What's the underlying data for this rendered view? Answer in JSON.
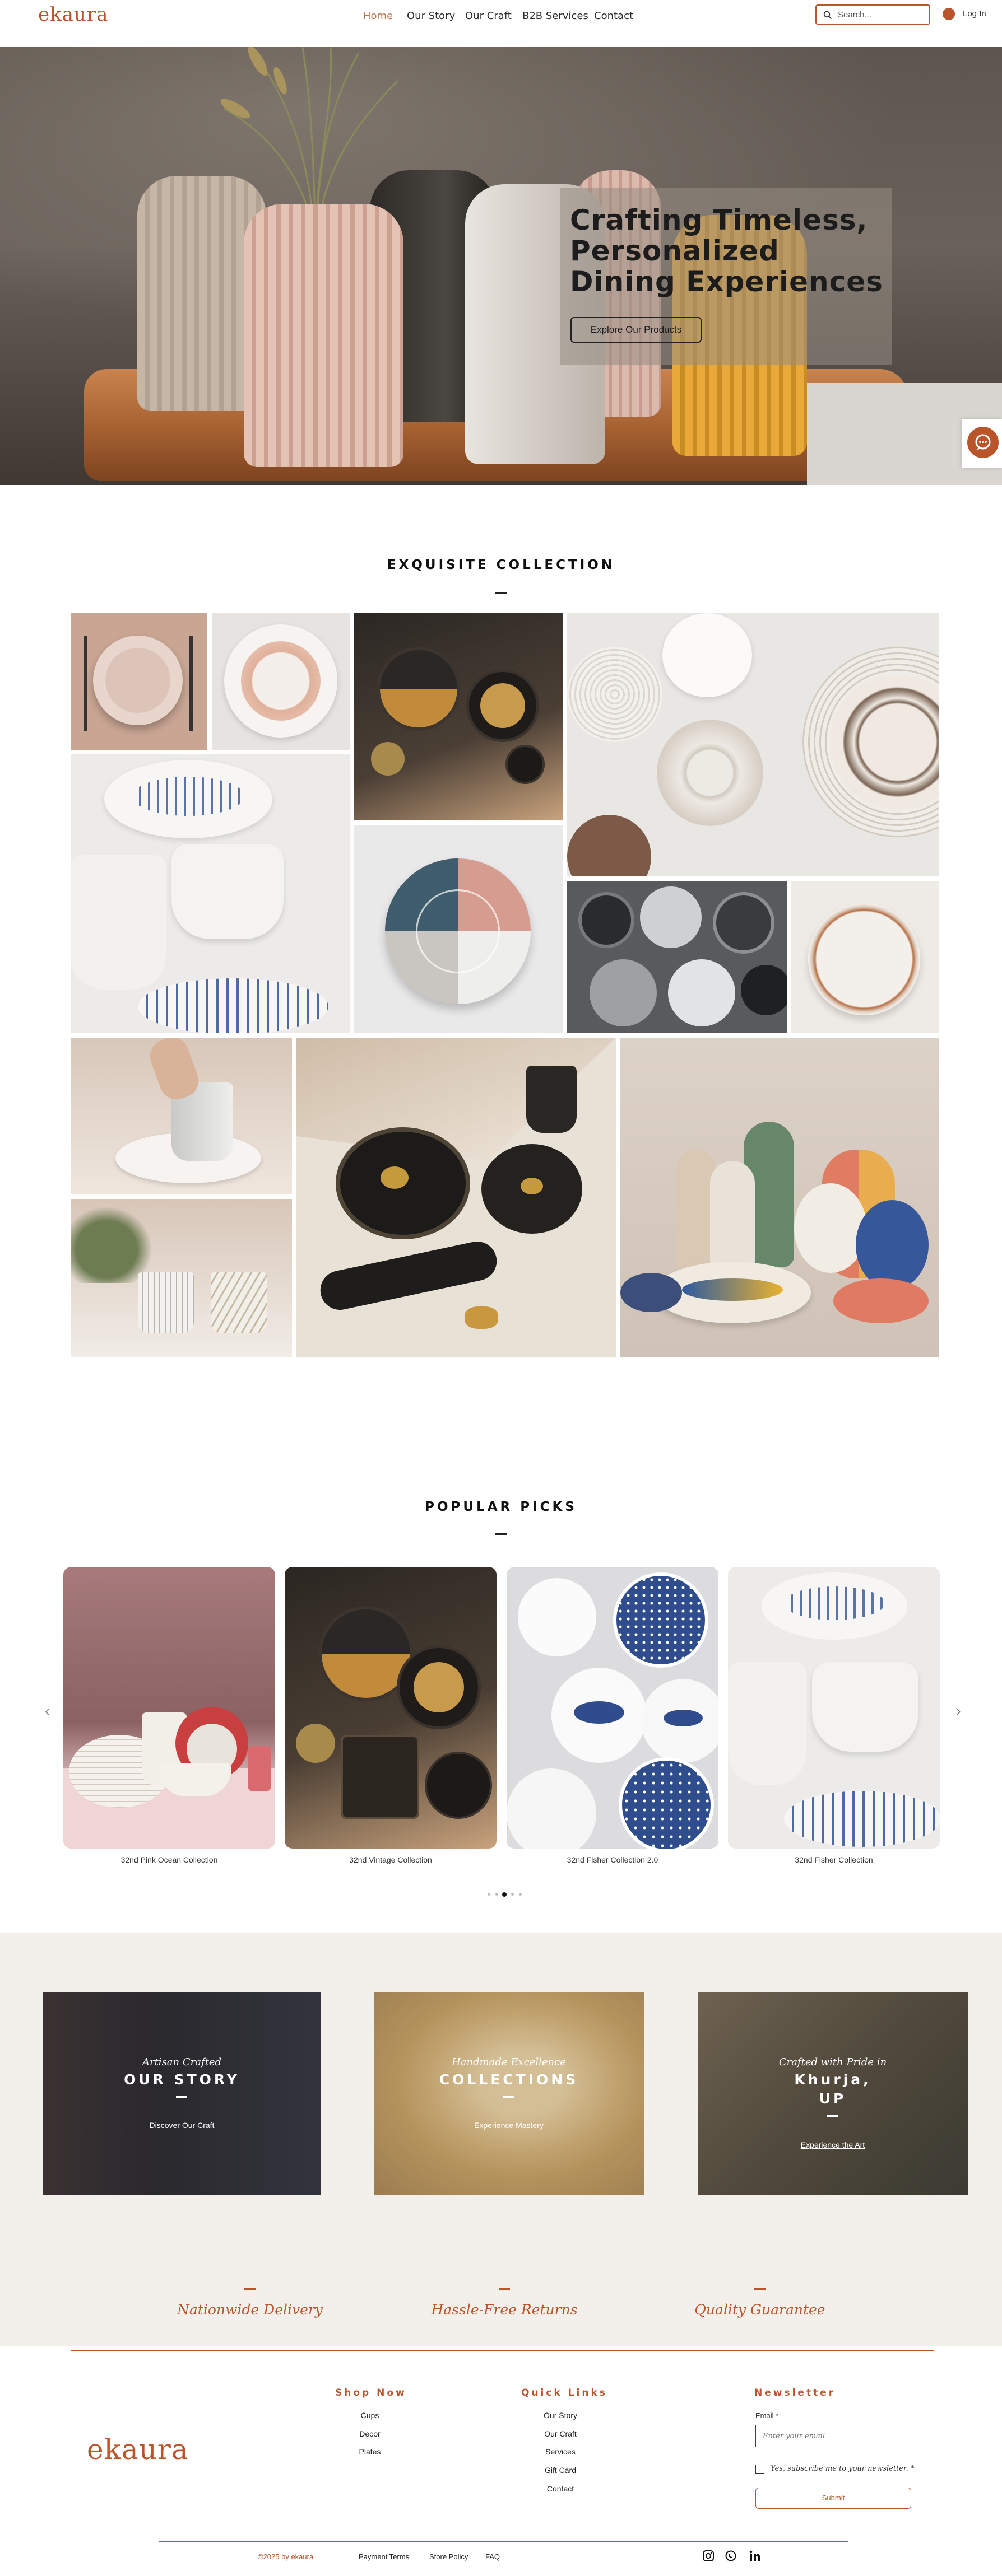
{
  "header": {
    "logo": "ekaura",
    "nav": [
      "Home",
      "Our Story",
      "Our Craft",
      "B2B Services",
      "Contact"
    ],
    "search_placeholder": "Search...",
    "login": "Log In"
  },
  "hero": {
    "title": "Crafting Timeless, Personalized Dining Experiences",
    "button": "Explore Our Products"
  },
  "collection": {
    "title": "EXQUISITE COLLECTION"
  },
  "popular": {
    "title": "POPULAR PICKS",
    "items": [
      "32nd Pink Ocean Collection",
      "32nd Vintage Collection",
      "32nd Fisher Collection 2.0",
      "32nd Fisher Collection"
    ]
  },
  "story": {
    "panels": [
      {
        "italic": "Artisan Crafted",
        "title": "OUR STORY",
        "link": "Discover Our Craft"
      },
      {
        "italic": "Handmade Excellence",
        "title": "COLLECTIONS",
        "link": "Experience Mastery"
      },
      {
        "italic": "Crafted with Pride in",
        "title": "Khurja,",
        "title2": "UP",
        "link": "Experience the Art"
      }
    ],
    "features": [
      "Nationwide Delivery",
      "Hassle-Free Returns",
      "Quality Guarantee"
    ]
  },
  "footer": {
    "logo": "ekaura",
    "shop_title": "Shop Now",
    "shop_links": [
      "Cups",
      "Decor",
      "Plates"
    ],
    "quick_title": "Quick Links",
    "quick_links": [
      "Our Story",
      "Our Craft",
      "Services",
      "Gift Card",
      "Contact"
    ],
    "news_title": "Newsletter",
    "email_label": "Email *",
    "email_placeholder": "Enter your email",
    "checkbox_label": "Yes, subscribe me to your newsletter. *",
    "submit": "Submit",
    "copyright": "©2025 by ekaura",
    "bottom_links": [
      "Payment Terms",
      "Store Policy",
      "FAQ"
    ]
  },
  "colors": {
    "brand": "#b9542b"
  }
}
